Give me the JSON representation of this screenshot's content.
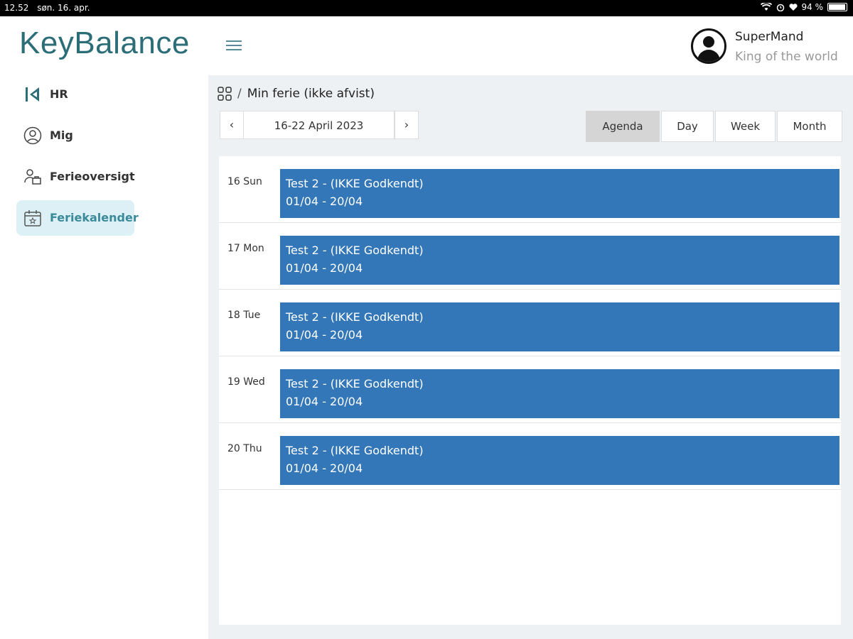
{
  "status_bar": {
    "time": "12.52",
    "date": "søn. 16. apr.",
    "battery": "94 %",
    "battery_level": 0.94
  },
  "app": {
    "logo_text": "KeyBalance"
  },
  "user": {
    "name": "SuperMand",
    "subtitle": "King of the world"
  },
  "sidebar": {
    "items": [
      {
        "label": "HR",
        "icon": "hr-icon",
        "active": false
      },
      {
        "label": "Mig",
        "icon": "person-icon",
        "active": false
      },
      {
        "label": "Ferieoversigt",
        "icon": "people-briefcase-icon",
        "active": false
      },
      {
        "label": "Feriekalender",
        "icon": "calendar-icon",
        "active": true
      }
    ]
  },
  "breadcrumb": {
    "separator": "/",
    "title": "Min ferie (ikke afvist)"
  },
  "calendar": {
    "prev_label": "‹",
    "next_label": "›",
    "range_label": "16-22 April 2023",
    "views": [
      {
        "label": "Agenda",
        "active": true
      },
      {
        "label": "Day",
        "active": false
      },
      {
        "label": "Week",
        "active": false
      },
      {
        "label": "Month",
        "active": false
      }
    ],
    "agenda": [
      {
        "date": "16 Sun",
        "title": "Test 2 - (IKKE Godkendt)",
        "range": "01/04 - 20/04"
      },
      {
        "date": "17 Mon",
        "title": "Test 2 - (IKKE Godkendt)",
        "range": "01/04 - 20/04"
      },
      {
        "date": "18 Tue",
        "title": "Test 2 - (IKKE Godkendt)",
        "range": "01/04 - 20/04"
      },
      {
        "date": "19 Wed",
        "title": "Test 2 - (IKKE Godkendt)",
        "range": "01/04 - 20/04"
      },
      {
        "date": "20 Thu",
        "title": "Test 2 - (IKKE Godkendt)",
        "range": "01/04 - 20/04"
      }
    ]
  },
  "colors": {
    "brand": "#2c6e78",
    "event": "#3377b8",
    "active_nav_bg": "#dcf0f5"
  }
}
